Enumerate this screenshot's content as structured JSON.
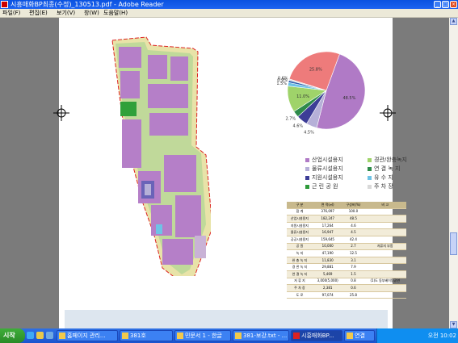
{
  "window": {
    "title": "시흥매화BP최종(수정)_130513.pdf - Adobe Reader",
    "minimize_glyph": "_",
    "maximize_glyph": "□",
    "close_glyph": "×"
  },
  "menu": [
    "파일(F)",
    "편집(E)",
    "보기(V)",
    "창(W)",
    "도움말(H)"
  ],
  "pie": {
    "slices": [
      {
        "label": "48.5%",
        "value": 48.5,
        "color": "#b07ac6"
      },
      {
        "label": "4.5%",
        "value": 4.5,
        "color": "#b6b0d8"
      },
      {
        "label": "4.6%",
        "value": 4.6,
        "color": "#3d3d97"
      },
      {
        "label": "2.7%",
        "value": 2.7,
        "color": "#2e8b4a"
      },
      {
        "label": "11.0%",
        "value": 11.0,
        "color": "#9fd36a"
      },
      {
        "label": "1.5%",
        "value": 1.5,
        "color": "#6ec3e6"
      },
      {
        "label": "0.9%",
        "value": 0.9,
        "color": "#2d5fae"
      },
      {
        "label": "0.6%",
        "value": 0.6,
        "color": "#d9d9d9"
      },
      {
        "label": "25.8%",
        "value": 25.8,
        "color": "#ee7b7b"
      }
    ]
  },
  "legend": [
    {
      "label": "산업시설용지",
      "color": "#b07ac6"
    },
    {
      "label": "경관/완충녹지",
      "color": "#9fd36a"
    },
    {
      "label": "물류시설용지",
      "color": "#b6b0d8"
    },
    {
      "label": "연 결 녹 지",
      "color": "#2e8b4a"
    },
    {
      "label": "지원시설용지",
      "color": "#3d3d97"
    },
    {
      "label": "유 수 지",
      "color": "#6ec3e6"
    },
    {
      "label": "근 린 공 원",
      "color": "#2e9a3a"
    },
    {
      "label": "주 차 장",
      "color": "#d9d9d9"
    }
  ],
  "table": {
    "headers": [
      "구 분",
      "면 적(㎡)",
      "구성비(%)",
      "비 고"
    ],
    "rows": [
      [
        "합 계",
        "376,097",
        "100.0",
        ""
      ],
      [
        "산업시설용지",
        "182,247",
        "48.5",
        ""
      ],
      [
        "지원시설용지",
        "17,264",
        "4.6",
        ""
      ],
      [
        "물류시설용지",
        "16,947",
        "4.5",
        ""
      ],
      [
        "공공시설용지",
        "159,645",
        "42.4",
        ""
      ],
      [
        "공 원",
        "10,000",
        "2.7",
        "저류지 부함"
      ],
      [
        "녹 지",
        "47,190",
        "12.5",
        ""
      ],
      [
        "완 충 녹 지",
        "11,830",
        "3.1",
        ""
      ],
      [
        "경 관 녹 지",
        "29,881",
        "7.9",
        ""
      ],
      [
        "연 결 녹 지",
        "5,469",
        "1.5",
        ""
      ],
      [
        "저 류 지",
        "3,000(5,000)",
        "0.8",
        "(1)도 동부베이팅공연"
      ],
      [
        "주 차 장",
        "2,381",
        "0.6",
        ""
      ],
      [
        "도 로",
        "97,074",
        "25.8",
        ""
      ]
    ]
  },
  "taskbar": {
    "start": "시작",
    "tasks": [
      "홈페이지 관리...",
      "381호",
      "민문서 1 - 한글",
      "381-보강.txt - ...",
      "시흥매화BP...",
      "연결"
    ],
    "clock": "오전 10:02"
  }
}
